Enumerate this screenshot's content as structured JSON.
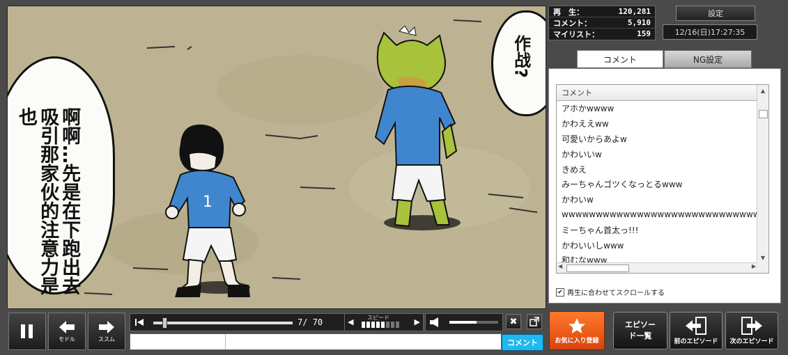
{
  "video": {
    "bubble_left_text": "啊啊…先是在下跑出去吸引那家伙的注意力是也",
    "bubble_right_text": "作战?"
  },
  "stats": {
    "views_label": "再　生：",
    "views_value": "120,281",
    "comments_label": "コメント：",
    "comments_value": "5,910",
    "mylist_label": "マイリスト：",
    "mylist_value": "159"
  },
  "header": {
    "settings_label": "設定",
    "datetime": "12/16(日)17:27:35"
  },
  "tabs": [
    {
      "label": "コメント"
    },
    {
      "label": "NG設定"
    }
  ],
  "comment_list": {
    "header": "コメント",
    "items": [
      "アホかwwww",
      "かわええww",
      "可愛いからあよw",
      "かわいいw",
      "きめえ",
      "みーちゃんゴツくなっとるwww",
      "かわいw",
      "wwwwwwwwwwwwwwwwwwwwwwwwwwwwwwww",
      "ミーちゃん首太っ!!!",
      "かわいいしwww",
      "和むなwww"
    ],
    "sync_label": "再生に合わせてスクロールする"
  },
  "controls": {
    "back_label": "モドル",
    "forward_label": "ススム",
    "time_current": "7",
    "time_total": "70",
    "speed_label": "スピード",
    "comment_send_label": "コメント",
    "seek_position": 0.065,
    "volume_level": 0.55
  },
  "nav": {
    "favorite_label": "お気に入り登録",
    "episode_list_label": "エピソード一覧",
    "prev_label": "前のエピソード",
    "next_label": "次のエピソード"
  }
}
